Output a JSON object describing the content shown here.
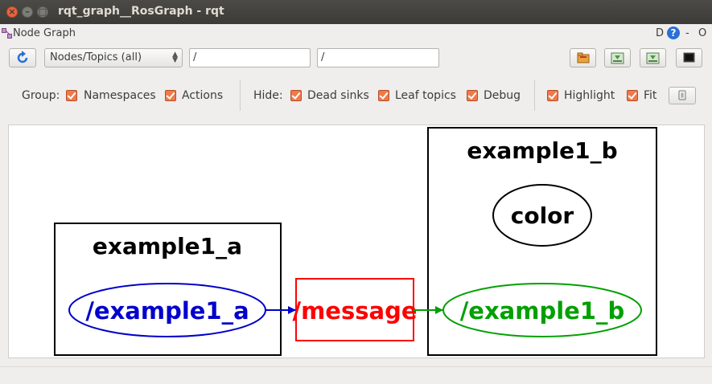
{
  "window": {
    "title": "rqt_graph__RosGraph - rqt"
  },
  "panel": {
    "title": "Node Graph",
    "d_label": "D",
    "help_label": "?",
    "minimize_label": "-",
    "close_label": "O"
  },
  "toolbar": {
    "view_mode": "Nodes/Topics (all)",
    "node_filter": "/",
    "topic_filter": "/"
  },
  "group": {
    "label": "Group:",
    "namespaces": "Namespaces",
    "actions": "Actions"
  },
  "hide": {
    "label": "Hide:",
    "dead_sinks": "Dead sinks",
    "leaf_topics": "Leaf topics",
    "debug": "Debug"
  },
  "options": {
    "highlight": "Highlight",
    "fit": "Fit"
  },
  "graph": {
    "cluster_a": "example1_a",
    "cluster_b": "example1_b",
    "node_a": "/example1_a",
    "node_b": "/example1_b",
    "node_color": "color",
    "topic": "/message",
    "colors": {
      "node_a": "#0000cc",
      "node_b": "#00a000",
      "topic": "#ff0000",
      "edge_a": "#0000cc",
      "edge_b": "#00a000"
    }
  }
}
